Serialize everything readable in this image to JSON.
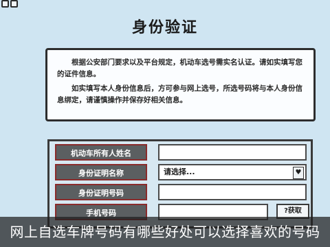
{
  "page": {
    "title": "身份验证"
  },
  "notice": {
    "para1": "根据公安部门要求以及平台规定，机动车选号需实名认证。请如实填写您的证件信息。",
    "para2": "如实填写本人身份信息后，方可参与网上选号，所选号码将与本人身份信息绑定，请谨慎操作并保存好相关信息。"
  },
  "form": {
    "rows": [
      {
        "label": "机动车所有人姓名",
        "value": ""
      },
      {
        "label": "身份证明名称",
        "value": "请选择...",
        "chevron": "♥"
      },
      {
        "label": "身份证明号码",
        "value": ""
      },
      {
        "label": "手机号码",
        "value": "",
        "button": "?获取"
      }
    ]
  },
  "caption": {
    "text": "网上自选车牌号码有哪些好处可以选择喜欢的号码"
  }
}
